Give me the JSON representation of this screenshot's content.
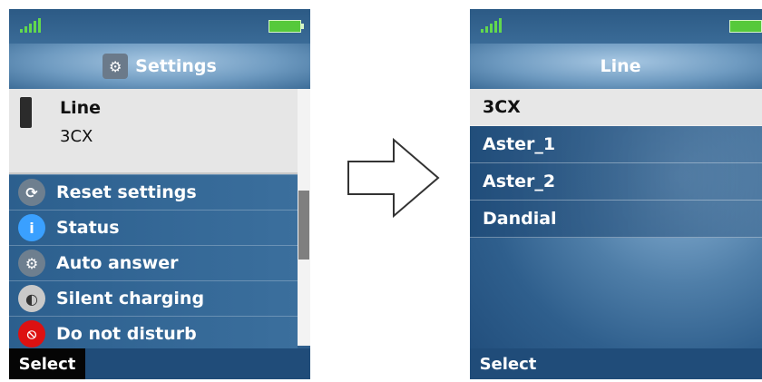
{
  "left": {
    "title": "Settings",
    "selected_item": {
      "label": "Line",
      "value": "3CX"
    },
    "menu_items": [
      {
        "label": "Reset settings",
        "icon": "reset-icon"
      },
      {
        "label": "Status",
        "icon": "info-icon"
      },
      {
        "label": "Auto answer",
        "icon": "gear-icon"
      },
      {
        "label": "Silent charging",
        "icon": "sound-icon"
      },
      {
        "label": "Do not disturb",
        "icon": "no-entry-icon"
      }
    ],
    "softkey": "Select"
  },
  "right": {
    "title": "Line",
    "items": [
      "3CX",
      "Aster_1",
      "Aster_2",
      "Dandial"
    ],
    "softkey": "Select"
  },
  "colors": {
    "bar_blue": "#204c79",
    "selection_gray": "#e6e6e6",
    "signal_green": "#62d84d"
  }
}
